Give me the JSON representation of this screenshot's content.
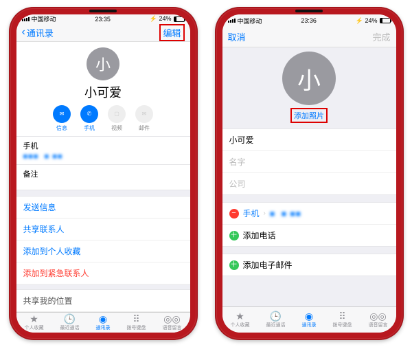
{
  "left": {
    "status": {
      "carrier": "中国移动",
      "time": "23:35",
      "battery": "24%"
    },
    "nav": {
      "back": "通讯录",
      "edit": "编辑"
    },
    "avatar_char": "小",
    "contact_name": "小可爱",
    "actions": {
      "message": "信息",
      "call": "手机",
      "video": "视频",
      "mail": "邮件"
    },
    "phone_section": {
      "label": "手机",
      "value": "■■■  ■ ■■"
    },
    "notes_label": "备注",
    "links": {
      "send_message": "发送信息",
      "share_contact": "共享联系人",
      "add_favorite": "添加到个人收藏",
      "add_emergency": "添加到紧急联系人",
      "share_location": "共享我的位置"
    },
    "tabs": {
      "favorites": "个人收藏",
      "recents": "最近通话",
      "contacts": "通讯录",
      "keypad": "拨号键盘",
      "voicemail": "语音留言"
    }
  },
  "right": {
    "status": {
      "carrier": "中国移动",
      "time": "23:36",
      "battery": "24%"
    },
    "nav": {
      "cancel": "取消",
      "done": "完成"
    },
    "avatar_char": "小",
    "add_photo": "添加照片",
    "fields": {
      "last_name": "小可爱",
      "first_name_placeholder": "名字",
      "company_placeholder": "公司"
    },
    "phone_row": {
      "label": "手机",
      "value": "■  ■ ■■"
    },
    "add_phone": "添加电话",
    "add_email": "添加电子邮件",
    "tabs": {
      "favorites": "个人收藏",
      "recents": "最近通话",
      "contacts": "通讯录",
      "keypad": "拨号键盘",
      "voicemail": "语音留言"
    }
  }
}
